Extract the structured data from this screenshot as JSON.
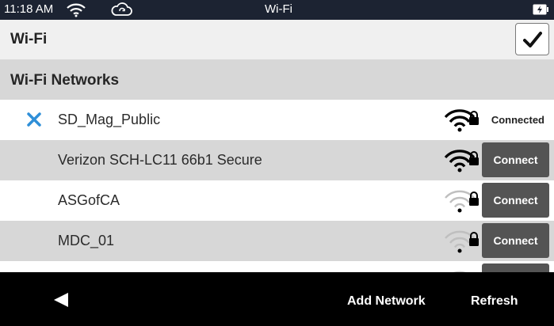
{
  "status_bar": {
    "time": "11:18 AM",
    "title": "Wi-Fi",
    "icons": [
      "wifi-icon",
      "sync-icon",
      "battery-charging-icon"
    ]
  },
  "header": {
    "title": "Wi-Fi",
    "confirm_icon": "checkmark-icon"
  },
  "section": {
    "label": "Wi-Fi Networks"
  },
  "networks": [
    {
      "ssid": "SD_Mag_Public",
      "status": "Connected",
      "selected_icon": "x-icon",
      "secured": true,
      "signal": "strong"
    },
    {
      "ssid": "Verizon SCH-LC11 66b1 Secure",
      "action": "Connect",
      "secured": true,
      "signal": "strong"
    },
    {
      "ssid": "ASGofCA",
      "action": "Connect",
      "secured": true,
      "signal": "weak"
    },
    {
      "ssid": "MDC_01",
      "action": "Connect",
      "secured": true,
      "signal": "weak"
    }
  ],
  "bottom_bar": {
    "back_icon": "back-arrow-icon",
    "add_network": "Add Network",
    "refresh": "Refresh"
  },
  "colors": {
    "status_bar": "#1c2332",
    "row_alt": "#d7d7d7",
    "button": "#545454",
    "selected_x": "#2f8fd8",
    "signal_strong": "#000000",
    "signal_weak": "#bfbfbf"
  }
}
